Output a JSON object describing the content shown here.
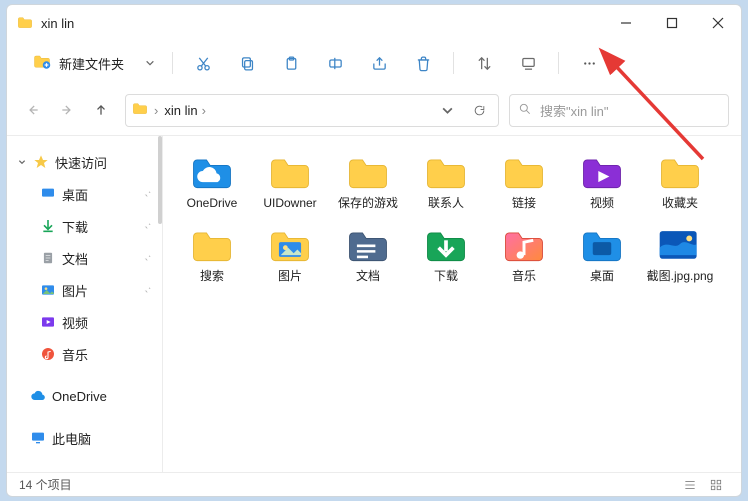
{
  "titlebar": {
    "title": "xin lin"
  },
  "toolbar": {
    "new_folder": "新建文件夹",
    "icons": {
      "cut": "cut-icon",
      "copy": "copy-icon",
      "paste": "paste-icon",
      "rename": "rename-icon",
      "share": "share-icon",
      "delete": "delete-icon",
      "sort": "sort-icon",
      "view": "view-icon",
      "more": "more-icon"
    }
  },
  "nav": {
    "back": "back",
    "forward": "forward",
    "up": "up"
  },
  "breadcrumb": {
    "segment": "xin lin",
    "chevron": "›"
  },
  "search": {
    "placeholder": "搜索\"xin lin\""
  },
  "sidebar": {
    "quick_access": "快速访问",
    "items": [
      {
        "label": "桌面",
        "icon": "desktop",
        "pinned": true
      },
      {
        "label": "下载",
        "icon": "download",
        "pinned": true
      },
      {
        "label": "文档",
        "icon": "document",
        "pinned": true
      },
      {
        "label": "图片",
        "icon": "picture",
        "pinned": true
      },
      {
        "label": "视频",
        "icon": "video",
        "pinned": false
      },
      {
        "label": "音乐",
        "icon": "music",
        "pinned": false
      }
    ],
    "onedrive": "OneDrive",
    "thispc": "此电脑"
  },
  "content": {
    "items": [
      {
        "label": "OneDrive",
        "kind": "folder",
        "accent": "onedrive"
      },
      {
        "label": "UIDowner",
        "kind": "folder",
        "accent": "plain"
      },
      {
        "label": "保存的游戏",
        "kind": "folder",
        "accent": "plain"
      },
      {
        "label": "联系人",
        "kind": "folder",
        "accent": "plain"
      },
      {
        "label": "链接",
        "kind": "folder",
        "accent": "plain"
      },
      {
        "label": "视频",
        "kind": "folder",
        "accent": "video"
      },
      {
        "label": "收藏夹",
        "kind": "folder",
        "accent": "plain"
      },
      {
        "label": "搜索",
        "kind": "folder",
        "accent": "plain"
      },
      {
        "label": "图片",
        "kind": "folder",
        "accent": "picture"
      },
      {
        "label": "文档",
        "kind": "folder",
        "accent": "document"
      },
      {
        "label": "下载",
        "kind": "folder",
        "accent": "download"
      },
      {
        "label": "音乐",
        "kind": "folder",
        "accent": "music"
      },
      {
        "label": "桌面",
        "kind": "folder",
        "accent": "desktop"
      },
      {
        "label": "截图.jpg.png",
        "kind": "image",
        "accent": "image"
      }
    ]
  },
  "status": {
    "count_text": "14 个项目"
  }
}
